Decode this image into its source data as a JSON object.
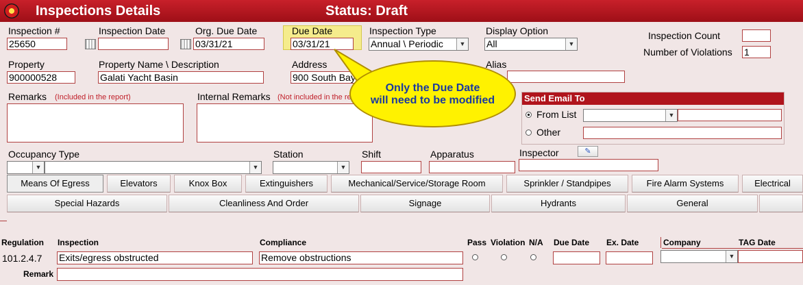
{
  "window": {
    "title": "Inspections Details",
    "status": "Status: Draft"
  },
  "form": {
    "inspection_number": {
      "label": "Inspection #",
      "value": "25650"
    },
    "inspection_date": {
      "label": "Inspection Date",
      "value": ""
    },
    "org_due_date": {
      "label": "Org. Due Date",
      "value": "03/31/21"
    },
    "due_date": {
      "label": "Due Date",
      "value": "03/31/21"
    },
    "inspection_type": {
      "label": "Inspection Type",
      "value": "Annual \\ Periodic"
    },
    "display_option": {
      "label": "Display Option",
      "value": "All"
    },
    "inspection_count": {
      "label": "Inspection Count",
      "value": ""
    },
    "number_of_violations": {
      "label": "Number of Violations",
      "value": "1"
    },
    "property": {
      "label": "Property",
      "value": "900000528"
    },
    "property_name": {
      "label": "Property Name \\ Description",
      "value": "Galati Yacht Basin"
    },
    "address": {
      "label": "Address",
      "value": "900 South Bay"
    },
    "alias": {
      "label": "Alias",
      "value": ""
    },
    "remarks": {
      "label": "Remarks",
      "note": "(Included in the report)"
    },
    "internal_remarks": {
      "label": "Internal Remarks",
      "note": "(Not included in the re"
    },
    "occupancy_type": {
      "label": "Occupancy Type"
    },
    "station": {
      "label": "Station"
    },
    "shift": {
      "label": "Shift"
    },
    "apparatus": {
      "label": "Apparatus"
    },
    "inspector": {
      "label": "Inspector"
    }
  },
  "email": {
    "title": "Send Email To",
    "from_list": "From List",
    "other": "Other"
  },
  "callout": {
    "line1": "Only the Due Date",
    "line2": "will need to be modified"
  },
  "tabs_row1": [
    "Means Of Egress",
    "Elevators",
    "Knox Box",
    "Extinguishers",
    "Mechanical/Service/Storage Room",
    "Sprinkler /  Standpipes",
    "Fire Alarm Systems",
    "Electrical"
  ],
  "tabs_row2": [
    "Special Hazards",
    "Cleanliness And Order",
    "Signage",
    "Hydrants",
    "General",
    ""
  ],
  "grid": {
    "headers": {
      "regulation": "Regulation",
      "inspection": "Inspection",
      "compliance": "Compliance",
      "pass": "Pass",
      "violation": "Violation",
      "na": "N/A",
      "due_date": "Due Date",
      "ex_date": "Ex. Date",
      "company": "Company",
      "tag_date": "TAG Date"
    },
    "row": {
      "regulation": "101.2.4.7",
      "inspection": "Exits/egress obstructed",
      "compliance": "Remove obstructions",
      "remark_label": "Remark"
    }
  },
  "colors": {
    "titlebar": "#b0141c",
    "background": "#f1e6e6",
    "callout": "#fff200",
    "highlight": "#f5ec8c"
  }
}
